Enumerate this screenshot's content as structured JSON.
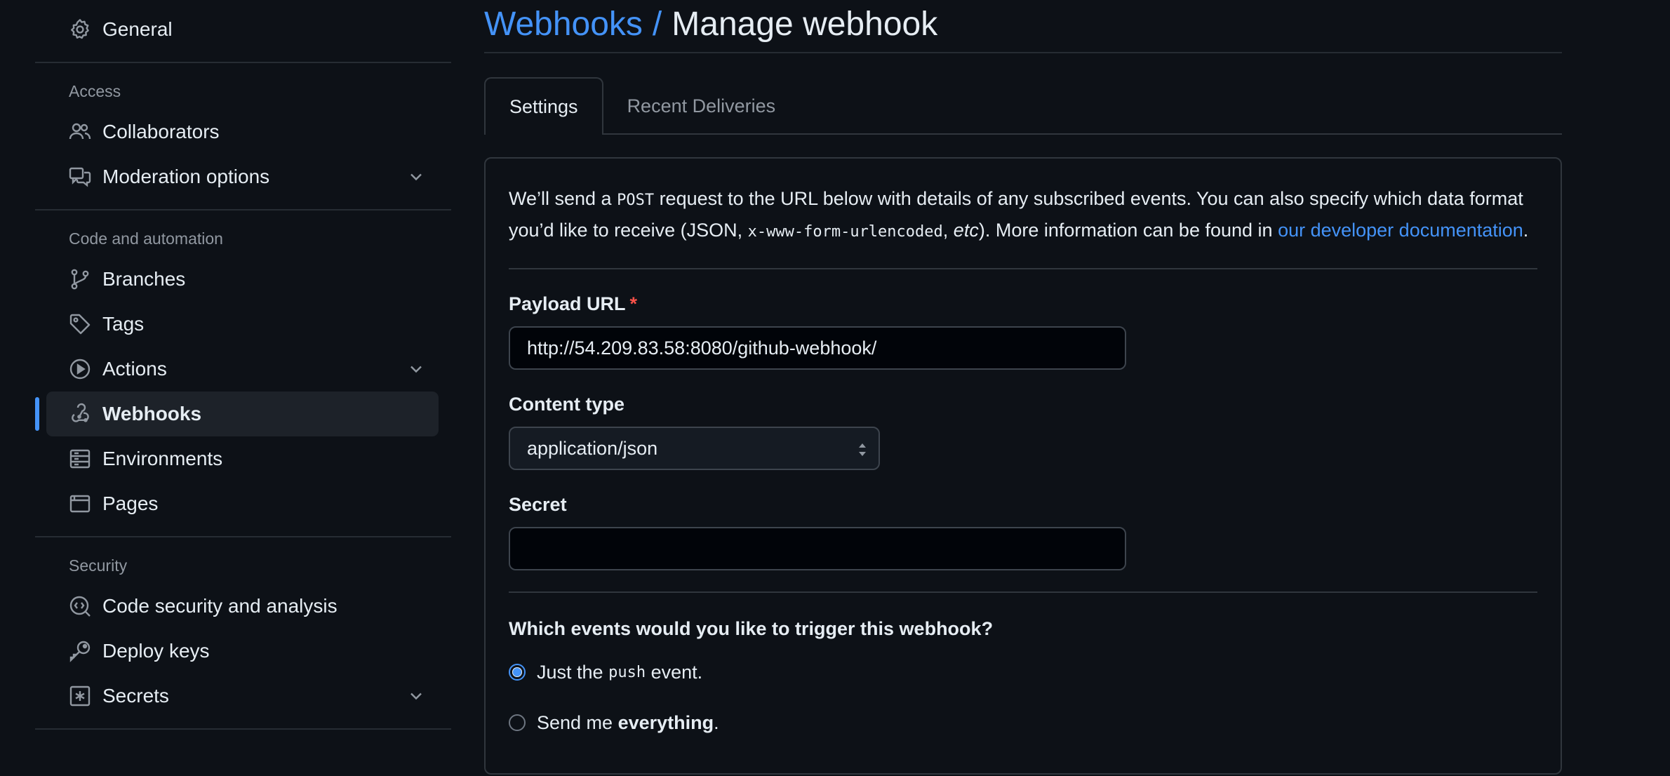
{
  "sidebar": {
    "general": "General",
    "access_heading": "Access",
    "collaborators": "Collaborators",
    "moderation": "Moderation options",
    "code_heading": "Code and automation",
    "branches": "Branches",
    "tags": "Tags",
    "actions": "Actions",
    "webhooks": "Webhooks",
    "environments": "Environments",
    "pages": "Pages",
    "security_heading": "Security",
    "code_security": "Code security and analysis",
    "deploy_keys": "Deploy keys",
    "secrets": "Secrets"
  },
  "header": {
    "breadcrumb": "Webhooks",
    "separator": "/",
    "title": "Manage webhook"
  },
  "tabs": {
    "settings": "Settings",
    "recent_deliveries": "Recent Deliveries"
  },
  "description": {
    "part1": "We’ll send a ",
    "code1": "POST",
    "part2": " request to the URL below with details of any subscribed events. You can also specify which data format you’d like to receive (JSON, ",
    "code2": "x-www-form-urlencoded",
    "part3": ", ",
    "etc": "etc",
    "part4": "). More information can be found in ",
    "link": "our developer documentation",
    "part5": "."
  },
  "form": {
    "payload_label": "Payload URL",
    "required_mark": "*",
    "payload_value": "http://54.209.83.58:8080/github-webhook/",
    "content_type_label": "Content type",
    "content_type_value": "application/json",
    "secret_label": "Secret",
    "secret_value": "",
    "events_question": "Which events would you like to trigger this webhook?",
    "option1_prefix": "Just the ",
    "option1_code": "push",
    "option1_suffix": " event.",
    "option2_prefix": "Send me ",
    "option2_bold": "everything",
    "option2_suffix": "."
  },
  "colors": {
    "accent": "#4493f8",
    "background": "#0d1117",
    "danger": "#f85149"
  }
}
